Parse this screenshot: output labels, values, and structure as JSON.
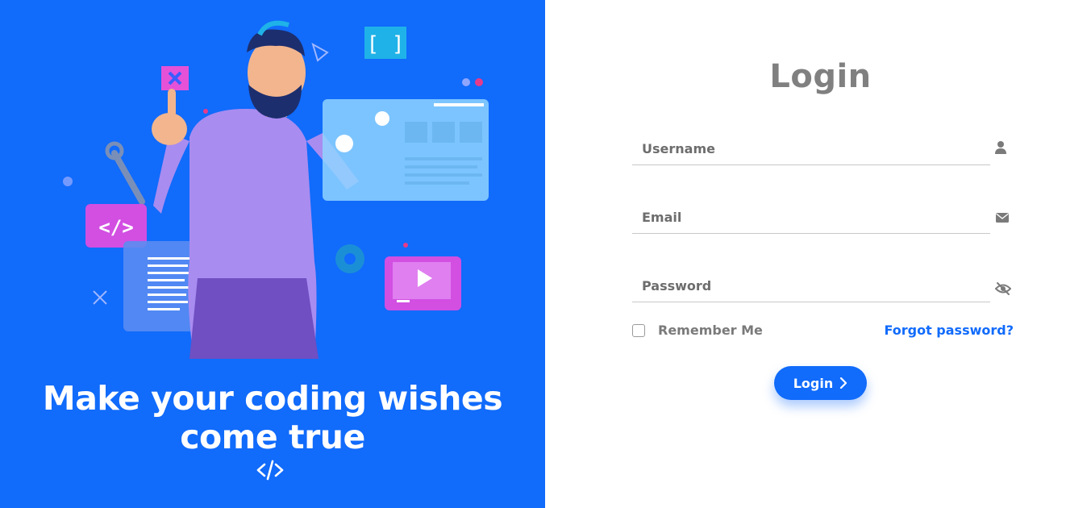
{
  "hero": {
    "tagline_line1": "Make your coding wishes",
    "tagline_line2": "come true",
    "icon": "code-slash-icon"
  },
  "login": {
    "title": "Login",
    "username_placeholder": "Username",
    "email_placeholder": "Email",
    "password_placeholder": "Password",
    "remember_label": "Remember Me",
    "forgot_label": "Forgot password?",
    "submit_label": "Login",
    "icons": {
      "username": "user-icon",
      "email": "envelope-icon",
      "password": "eye-slash-icon",
      "submit": "chevron-right-icon"
    }
  },
  "colors": {
    "primary": "#116bfb",
    "title_gray": "#808080"
  }
}
